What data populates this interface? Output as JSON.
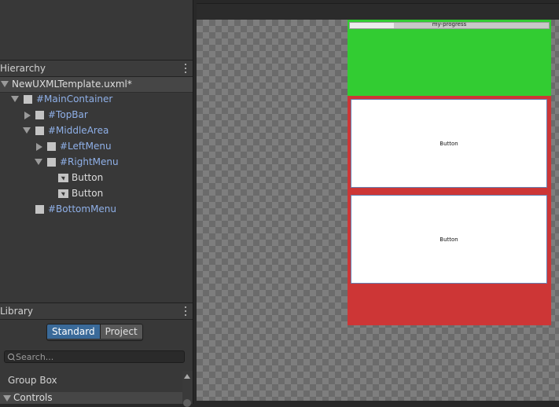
{
  "hierarchy": {
    "title": "Hierarchy",
    "document": "NewUXMLTemplate.uxml*",
    "items": [
      {
        "label": "#MainContainer"
      },
      {
        "label": "#TopBar"
      },
      {
        "label": "#MiddleArea"
      },
      {
        "label": "#LeftMenu"
      },
      {
        "label": "#RightMenu"
      },
      {
        "label": "Button"
      },
      {
        "label": "Button"
      },
      {
        "label": "#BottomMenu"
      }
    ]
  },
  "library": {
    "title": "Library",
    "tabs": [
      "Standard",
      "Project"
    ],
    "active_tab": "Standard",
    "search_placeholder": "Search...",
    "items": [
      "Group Box"
    ],
    "categories": [
      "Controls"
    ]
  },
  "viewport": {
    "progress_label": "my-progress",
    "progress_fraction": 0.22,
    "buttons": [
      "Button",
      "Button"
    ]
  },
  "colors": {
    "green_area": "#32cc32",
    "red_area": "#cd3636",
    "selection": "#3a6a99",
    "id_text": "#8fb0e8"
  },
  "icons": [
    "kebab-menu-icon",
    "element-box-icon",
    "button-element-icon",
    "search-icon",
    "expand-arrow-icon",
    "collapse-arrow-icon"
  ]
}
